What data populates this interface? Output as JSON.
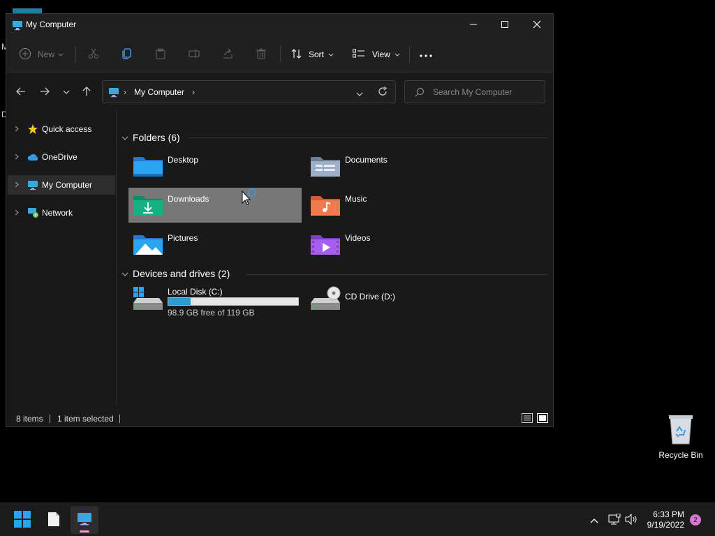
{
  "window": {
    "title": "My Computer",
    "minimize_icon": "minimize-icon",
    "maximize_icon": "maximize-icon",
    "close_icon": "close-icon"
  },
  "toolbar": {
    "new_label": "New",
    "sort_label": "Sort",
    "view_label": "View",
    "icons": [
      "new-icon",
      "cut-icon",
      "copy-icon",
      "paste-icon",
      "rename-icon",
      "share-icon",
      "delete-icon",
      "sort-icon",
      "view-icon",
      "more-icon"
    ]
  },
  "address": {
    "location": "My Computer",
    "search_placeholder": "Search My Computer"
  },
  "sidebar": {
    "items": [
      {
        "label": "Quick access",
        "icon": "star-icon"
      },
      {
        "label": "OneDrive",
        "icon": "cloud-icon"
      },
      {
        "label": "My Computer",
        "icon": "computer-icon",
        "selected": true
      },
      {
        "label": "Network",
        "icon": "network-icon"
      }
    ]
  },
  "folders": {
    "header": "Folders (6)",
    "items": [
      {
        "label": "Desktop",
        "icon": "desktop-folder-icon"
      },
      {
        "label": "Documents",
        "icon": "documents-folder-icon"
      },
      {
        "label": "Downloads",
        "icon": "downloads-folder-icon",
        "selected": true
      },
      {
        "label": "Music",
        "icon": "music-folder-icon"
      },
      {
        "label": "Pictures",
        "icon": "pictures-folder-icon"
      },
      {
        "label": "Videos",
        "icon": "videos-folder-icon"
      }
    ]
  },
  "drives": {
    "header": "Devices and drives (2)",
    "items": [
      {
        "label": "Local Disk (C:)",
        "free_text": "98.9 GB free of 119 GB",
        "used_fraction": 0.17,
        "icon": "hard-disk-icon"
      },
      {
        "label": "CD Drive (D:)",
        "icon": "cd-drive-icon"
      }
    ]
  },
  "status": {
    "items_count": "8 items",
    "selection": "1 item selected"
  },
  "desktop": {
    "recycle_bin_label": "Recycle Bin",
    "fragment_letter_1": "M",
    "fragment_letter_2": "D"
  },
  "taskbar": {
    "time": "6:33 PM",
    "date": "9/19/2022",
    "notification_count": "2"
  },
  "colors": {
    "accent": "#26a0da",
    "selection": "#777777",
    "window_bg": "#191919"
  }
}
